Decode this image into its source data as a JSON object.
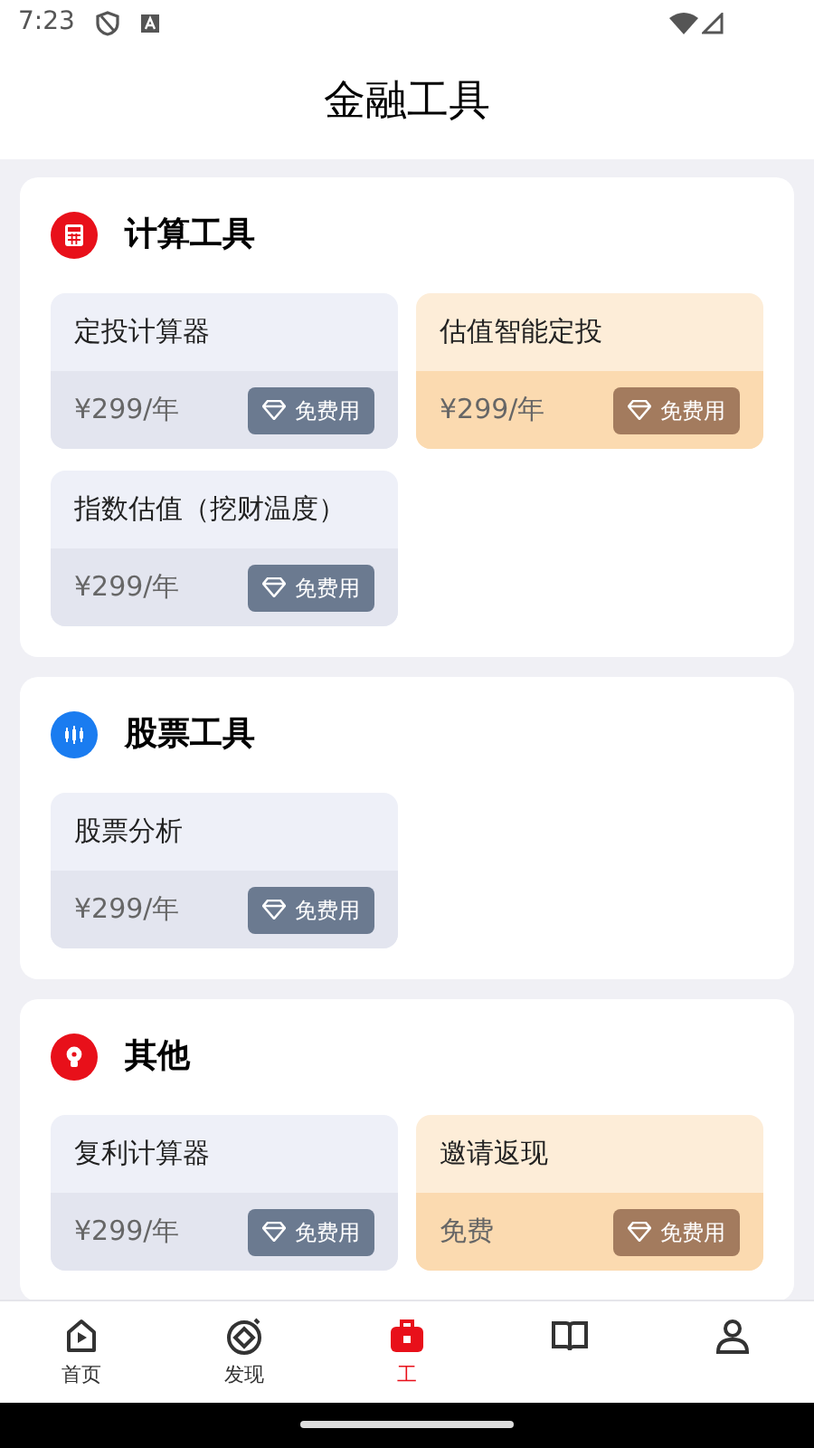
{
  "status_bar": {
    "time": "7:23"
  },
  "title": "金融工具",
  "sections": [
    {
      "title": "计算工具",
      "kind": "calculator",
      "tools": [
        {
          "name": "定投计算器",
          "price": "¥299/年",
          "action": "免费用",
          "kind": "standard"
        },
        {
          "name": "估值智能定投",
          "price": "¥299/年",
          "action": "免费用",
          "kind": "premium"
        },
        {
          "name": "指数估值（挖财温度）",
          "price": "¥299/年",
          "action": "免费用",
          "kind": "standard"
        }
      ]
    },
    {
      "title": "股票工具",
      "kind": "candlestick",
      "tools": [
        {
          "name": "股票分析",
          "price": "¥299/年",
          "action": "免费用",
          "kind": "standard"
        }
      ]
    },
    {
      "title": "其他",
      "kind": "bulb",
      "tools": [
        {
          "name": "复利计算器",
          "price": "¥299/年",
          "action": "免费用",
          "kind": "standard"
        },
        {
          "name": "邀请返现",
          "price": "免费",
          "action": "免费用",
          "kind": "premium"
        }
      ]
    }
  ],
  "nav": [
    {
      "label": "首页",
      "kind": "home",
      "selected": false
    },
    {
      "label": "发现",
      "kind": "discover",
      "selected": false
    },
    {
      "label": "工",
      "kind": "toolbox",
      "selected": true
    },
    {
      "kind": "book",
      "selected": false
    },
    {
      "kind": "person",
      "selected": false
    }
  ]
}
